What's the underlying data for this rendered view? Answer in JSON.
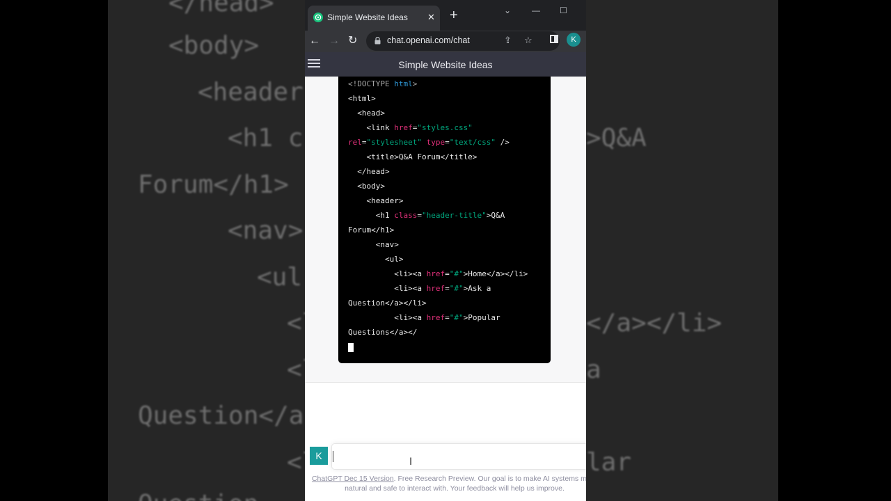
{
  "backdrop": {
    "left_lines": [
      "</head>",
      "<body>",
      "<header",
      "<h1 c",
      "Forum</h1>",
      "<nav>",
      "<ul",
      "<l",
      "<l",
      "Question</a",
      "<l",
      "Ouestion"
    ],
    "right_lines": [
      ">Q&A",
      "</a></li>",
      "a",
      "lar"
    ]
  },
  "browser": {
    "tab_title": "Simple Website Ideas",
    "url": "chat.openai.com/chat",
    "profile_initial": "K"
  },
  "app": {
    "title": "Simple Website Ideas"
  },
  "code_lines": [
    [
      {
        "c": "muted",
        "t": "<!DOCTYPE "
      },
      {
        "c": "kw",
        "t": "html"
      },
      {
        "c": "muted",
        "t": ">"
      }
    ],
    [
      {
        "c": "t",
        "t": "<html>"
      }
    ],
    [
      {
        "c": "t",
        "t": "  <head>"
      }
    ],
    [
      {
        "c": "t",
        "t": "    <link "
      },
      {
        "c": "attr",
        "t": "href"
      },
      {
        "c": "t",
        "t": "="
      },
      {
        "c": "str",
        "t": "\"styles.css\""
      }
    ],
    [
      {
        "c": "attr",
        "t": "rel"
      },
      {
        "c": "t",
        "t": "="
      },
      {
        "c": "str",
        "t": "\"stylesheet\""
      },
      {
        "c": "t",
        "t": " "
      },
      {
        "c": "attr",
        "t": "type"
      },
      {
        "c": "t",
        "t": "="
      },
      {
        "c": "str",
        "t": "\"text/css\""
      },
      {
        "c": "t",
        "t": " />"
      }
    ],
    [
      {
        "c": "t",
        "t": "    <title>Q&A Forum</title>"
      }
    ],
    [
      {
        "c": "t",
        "t": "  </head>"
      }
    ],
    [
      {
        "c": "t",
        "t": "  <body>"
      }
    ],
    [
      {
        "c": "t",
        "t": "    <header>"
      }
    ],
    [
      {
        "c": "t",
        "t": "      <h1 "
      },
      {
        "c": "attr",
        "t": "class"
      },
      {
        "c": "t",
        "t": "="
      },
      {
        "c": "str",
        "t": "\"header-title\""
      },
      {
        "c": "t",
        "t": ">Q&A"
      }
    ],
    [
      {
        "c": "t",
        "t": "Forum</h1>"
      }
    ],
    [
      {
        "c": "t",
        "t": "      <nav>"
      }
    ],
    [
      {
        "c": "t",
        "t": "        <ul>"
      }
    ],
    [
      {
        "c": "t",
        "t": "          <li><a "
      },
      {
        "c": "attr",
        "t": "href"
      },
      {
        "c": "t",
        "t": "="
      },
      {
        "c": "str",
        "t": "\"#\""
      },
      {
        "c": "t",
        "t": ">Home</a></li>"
      }
    ],
    [
      {
        "c": "t",
        "t": "          <li><a "
      },
      {
        "c": "attr",
        "t": "href"
      },
      {
        "c": "t",
        "t": "="
      },
      {
        "c": "str",
        "t": "\"#\""
      },
      {
        "c": "t",
        "t": ">Ask a"
      }
    ],
    [
      {
        "c": "t",
        "t": "Question</a></li>"
      }
    ],
    [
      {
        "c": "t",
        "t": "          <li><a "
      },
      {
        "c": "attr",
        "t": "href"
      },
      {
        "c": "t",
        "t": "="
      },
      {
        "c": "str",
        "t": "\"#\""
      },
      {
        "c": "t",
        "t": ">Popular"
      }
    ],
    [
      {
        "c": "t",
        "t": "Questions</a></"
      }
    ]
  ],
  "composer": {
    "user_initial": "K",
    "placeholder": ""
  },
  "footer": {
    "link_text": "ChatGPT Dec 15 Version",
    "text": ". Free Research Preview. Our goal is to make AI systems more",
    "line2": "natural and safe to interact with. Your feedback will help us improve."
  }
}
